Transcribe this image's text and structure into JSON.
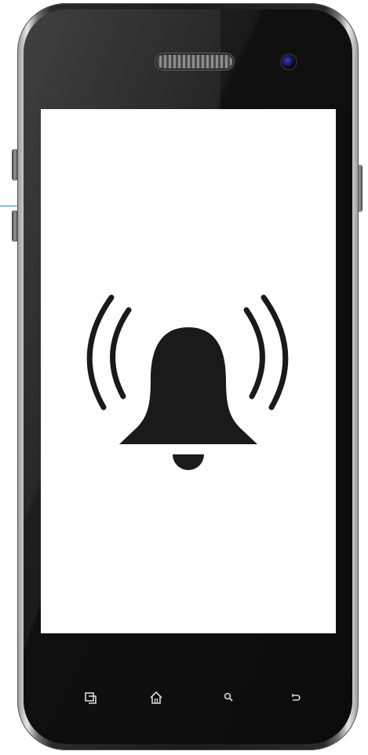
{
  "device": {
    "type": "smartphone",
    "screen_icon": "bell-ringing-icon",
    "nav_buttons": [
      {
        "name": "recent-apps-icon"
      },
      {
        "name": "home-icon"
      },
      {
        "name": "search-icon"
      },
      {
        "name": "back-icon"
      }
    ]
  },
  "colors": {
    "screen": "#fefefe",
    "bezel": "#111111",
    "bell": "#1a1a1a"
  }
}
